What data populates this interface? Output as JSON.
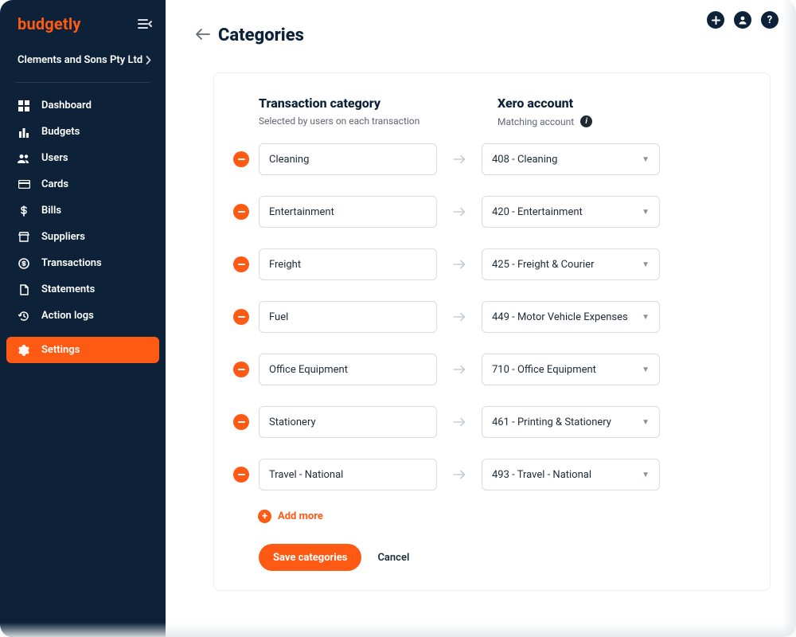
{
  "brand": "budgetly",
  "company": {
    "name": "Clements and Sons Pty Ltd"
  },
  "sidebar": {
    "items": [
      {
        "label": "Dashboard"
      },
      {
        "label": "Budgets"
      },
      {
        "label": "Users"
      },
      {
        "label": "Cards"
      },
      {
        "label": "Bills"
      },
      {
        "label": "Suppliers"
      },
      {
        "label": "Transactions"
      },
      {
        "label": "Statements"
      },
      {
        "label": "Action logs"
      },
      {
        "label": "Settings"
      }
    ]
  },
  "page": {
    "title": "Categories"
  },
  "columns": {
    "left_title": "Transaction category",
    "left_sub": "Selected by users on each transaction",
    "right_title": "Xero account",
    "right_sub": "Matching account"
  },
  "rows": [
    {
      "category": "Cleaning",
      "account": "408 - Cleaning"
    },
    {
      "category": "Entertainment",
      "account": "420 - Entertainment"
    },
    {
      "category": "Freight",
      "account": "425 - Freight & Courier"
    },
    {
      "category": "Fuel",
      "account": "449 - Motor Vehicle Expenses"
    },
    {
      "category": "Office Equipment",
      "account": "710 - Office Equipment"
    },
    {
      "category": "Stationery",
      "account": "461 - Printing & Stationery"
    },
    {
      "category": "Travel - National",
      "account": "493 - Travel - National"
    }
  ],
  "actions": {
    "add_more": "Add more",
    "save": "Save categories",
    "cancel": "Cancel"
  }
}
